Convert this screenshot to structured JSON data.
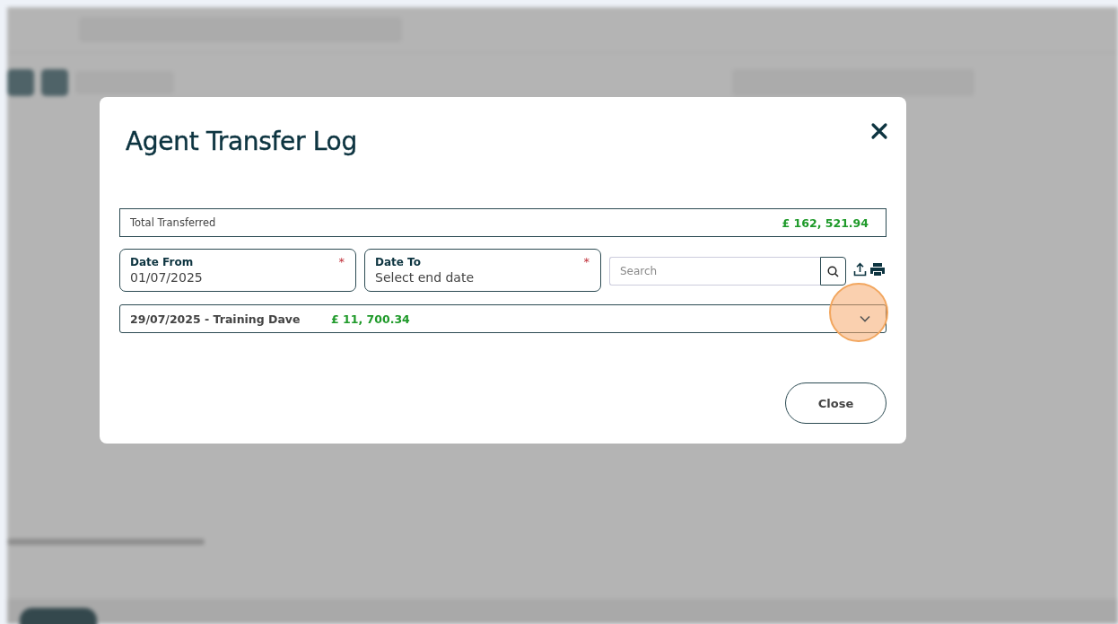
{
  "title": "Agent Transfer Log",
  "total": {
    "label": "Total Transferred",
    "value": "£ 162, 521.94"
  },
  "date_from": {
    "label": "Date From",
    "value": "01/07/2025",
    "required_mark": "*"
  },
  "date_to": {
    "label": "Date To",
    "placeholder": "Select end date",
    "required_mark": "*"
  },
  "search": {
    "placeholder": "Search"
  },
  "transfers": [
    {
      "label": "29/07/2025 - Training Dave",
      "amount": "£ 11, 700.34",
      "expanded": false
    }
  ],
  "buttons": [
    {
      "label": "Close"
    }
  ]
}
